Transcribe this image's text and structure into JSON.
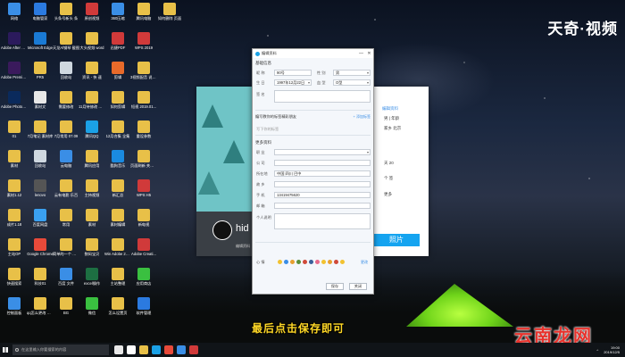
{
  "desktop_icons": [
    {
      "label": "网络",
      "color": "#3a8ee6"
    },
    {
      "label": "Adobe After Effects CC ...",
      "color": "#2b1a5c"
    },
    {
      "label": "Adobe Premiere P...",
      "color": "#3a1a5c"
    },
    {
      "label": "Adobe Photosh...",
      "color": "#0a2a5c"
    },
    {
      "label": "01",
      "color": "#e8c048"
    },
    {
      "label": "素材",
      "color": "#e8c048"
    },
    {
      "label": "素材1.12",
      "color": "#e8c048"
    },
    {
      "label": "成片1.18",
      "color": "#e8c048"
    },
    {
      "label": "主站OP",
      "color": "#e8c048"
    },
    {
      "label": "快速搜索",
      "color": "#e8c048"
    },
    {
      "label": "控制面板",
      "color": "#3a8ee6"
    },
    {
      "label": "电脑管家",
      "color": "#2b7ae0"
    },
    {
      "label": "Microsoft Edge",
      "color": "#1a7ad4"
    },
    {
      "label": "PR5",
      "color": "#e8c048"
    },
    {
      "label": "素材文",
      "color": "#e8e8e8"
    },
    {
      "label": "7月笔记 素材库",
      "color": "#e8c048"
    },
    {
      "label": "回收站",
      "color": "#cfd8e0"
    },
    {
      "label": "lenovo",
      "color": "#555"
    },
    {
      "label": "百度网盘",
      "color": "#3aa0f0"
    },
    {
      "label": "Google Chrome",
      "color": "#e84a3a"
    },
    {
      "label": "科技01",
      "color": "#e8c048"
    },
    {
      "label": "qq怎么更改 名字",
      "color": "#e8c048"
    },
    {
      "label": "头条号新头 条",
      "color": "#e8c048"
    },
    {
      "label": "天龙Al钢琴 截图",
      "color": "#e8c048"
    },
    {
      "label": "回收站",
      "color": "#cfd8e0"
    },
    {
      "label": "需要修改",
      "color": "#e8c048"
    },
    {
      "label": "7月常用 07.09",
      "color": "#e8c048"
    },
    {
      "label": "云电脑",
      "color": "#3a8ee6"
    },
    {
      "label": "云有电影 乐百",
      "color": "#e8c048"
    },
    {
      "label": "常用",
      "color": "#e8c048"
    },
    {
      "label": "简单的一个 截图",
      "color": "#e8c048"
    },
    {
      "label": "百度 文件",
      "color": "#3a8ee6"
    },
    {
      "label": "BG",
      "color": "#e8c048"
    },
    {
      "label": "原创视频",
      "color": "#d03a3a"
    },
    {
      "label": "大头视频 word",
      "color": "#e8c048"
    },
    {
      "label": "资讯 - 快 速",
      "color": "#e8c048"
    },
    {
      "label": "11月待修改 的视频",
      "color": "#e8c048"
    },
    {
      "label": "腾讯QQ",
      "color": "#1ba1e6"
    },
    {
      "label": "腾讯应用",
      "color": "#e8c048"
    },
    {
      "label": "主持视频",
      "color": "#e8c048"
    },
    {
      "label": "素材",
      "color": "#e8c048"
    },
    {
      "label": "数码宝贝",
      "color": "#e8c048"
    },
    {
      "label": "excel操作",
      "color": "#1d6f42"
    },
    {
      "label": "微信",
      "color": "#3ac040"
    },
    {
      "label": "360压缩",
      "color": "#3a8ee6"
    },
    {
      "label": "迅捷PDF",
      "color": "#d03a3a"
    },
    {
      "label": "剪辑",
      "color": "#e86a2a"
    },
    {
      "label": "如何剪辑",
      "color": "#e8c048"
    },
    {
      "label": "12月合集 全集",
      "color": "#e8c048"
    },
    {
      "label": "酷狗音乐",
      "color": "#1a8ae0"
    },
    {
      "label": "新汇总",
      "color": "#e8c048"
    },
    {
      "label": "素材编辑",
      "color": "#e8c048"
    },
    {
      "label": "Win Adobe 2018 正...",
      "color": "#e8c048"
    },
    {
      "label": "主站整理",
      "color": "#e8c048"
    },
    {
      "label": "怎么设置页",
      "color": "#e8c048"
    },
    {
      "label": "腾讯电脑",
      "color": "#e8c048"
    },
    {
      "label": "WPS 2019",
      "color": "#d03a3a"
    },
    {
      "label": "3视频配音 说说字幕",
      "color": "#e8c048"
    },
    {
      "label": "短视 2019.01...",
      "color": "#e8c048"
    },
    {
      "label": "重设参数",
      "color": "#e8c048"
    },
    {
      "label": "页面刷新 关闭页面",
      "color": "#e8c048"
    },
    {
      "label": "WPS H5",
      "color": "#d03a3a"
    },
    {
      "label": "新电视",
      "color": "#e8c048"
    },
    {
      "label": "Adobe Creati...",
      "color": "#d03a3a"
    },
    {
      "label": "应用商店",
      "color": "#3ac040"
    },
    {
      "label": "软件管理",
      "color": "#2b7ae0"
    },
    {
      "label": "如何删除 页面",
      "color": "#e8c048"
    }
  ],
  "watermark_top": "天奇·视频",
  "watermark_bottom": "云南龙网",
  "subtitle": "最后点击保存即可",
  "profile_card": {
    "nickname": "hid",
    "edit_hint": "编辑资料",
    "edit_link": "编辑资料",
    "lines": [
      "男 | 年龄",
      "家乡 北京",
      "天 20",
      "个 签",
      "更多"
    ],
    "photo_button": "照片"
  },
  "dialog": {
    "title": "编辑资料",
    "controls": [
      "—",
      "✕"
    ],
    "basic_section": "基础信息",
    "nickname_label": "昵 称",
    "nickname_value": "90号",
    "gender_label": "性 别",
    "gender_value": "男",
    "birthday_label": "生 日",
    "birthday_value": "1997年12月22日",
    "blood_label": "血 型",
    "blood_value": "O型",
    "sign_label": "签 名",
    "tags_section": "编写教你的标签精彩朋友",
    "tags_link": "+ 添加标签",
    "tags_placeholder": "写下你的标签",
    "more_section": "更多资料",
    "job_label": "职 业",
    "company_label": "公 司",
    "location_label": "所在地",
    "location_value": "中国 四川 巴中",
    "hometown_label": "故 乡",
    "phone_label": "手 机",
    "phone_value": "13419475620",
    "email_label": "邮 箱",
    "intro_label": "个人说明",
    "mood_label": "心 情",
    "mood_link": "更改",
    "save_label": "保存",
    "close_label": "关闭"
  },
  "taskbar": {
    "search_placeholder": "在这里输入你要搜索的内容",
    "icons": [
      "#e8e8e8",
      "#ffffff",
      "#e8c048",
      "#1ba1e6",
      "#e84a3a",
      "#3a8ee6",
      "#d03a3a"
    ],
    "time": "19:00",
    "date": "2019/12/5"
  }
}
